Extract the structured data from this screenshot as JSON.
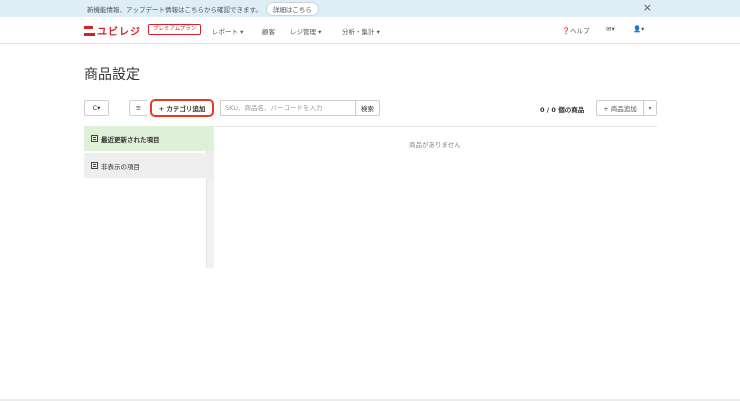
{
  "banner": {
    "text": "新機能情報、アップデート情報はこちらから確認できます。",
    "link": "詳細はこちら",
    "close": "×"
  },
  "navbar": {
    "logo": "ユビレジ",
    "premium": "プレミアムプラン",
    "items": [
      "レポート ▾",
      "顧客",
      "レジ管理 ▾",
      "分析・集計 ▾"
    ],
    "help": "❓ヘルプ",
    "mail": "✉▾",
    "user": "👤▾"
  },
  "page": {
    "title": "商品設定"
  },
  "toolbar": {
    "refresh": "C▾",
    "list_icon": "≡",
    "add_category": "+ カテゴリ追加",
    "search_placeholder": "SKU、商品名、バーコードを入力",
    "search_button": "検索",
    "count": "0 / 0 個の商品",
    "add_product": "+ 商品追加",
    "add_product_caret": "▾"
  },
  "sidebar": {
    "items": [
      "最近更新された項目",
      "非表示の項目"
    ]
  },
  "main": {
    "empty_message": "商品がありません"
  },
  "colors": {
    "brand": "#d2232a",
    "highlight": "#e53a24",
    "banner_bg": "#dfedf7",
    "selected_bg": "#dff0d8"
  }
}
